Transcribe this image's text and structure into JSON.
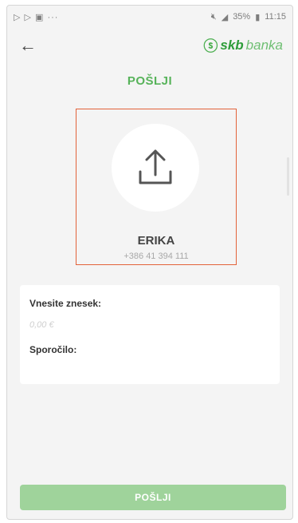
{
  "status_bar": {
    "left_icons": [
      "play-icon",
      "play-icon",
      "gallery-icon",
      "more-icon"
    ],
    "left_text": "▷ ▷ ▣ ···",
    "battery": "35%",
    "time": "11:15"
  },
  "header": {
    "logo_skb": "skb",
    "logo_banka": "banka"
  },
  "title": "POŠLJI",
  "recipient": {
    "name": "ERIKA",
    "phone": "+386 41 394 111"
  },
  "form": {
    "amount_label": "Vnesite znesek:",
    "amount_placeholder": "0,00 €",
    "message_label": "Sporočilo:"
  },
  "send_button": "POŠLJI",
  "colors": {
    "accent": "#57b35a",
    "button": "#9fd39b",
    "selection_border": "#e2623a"
  }
}
